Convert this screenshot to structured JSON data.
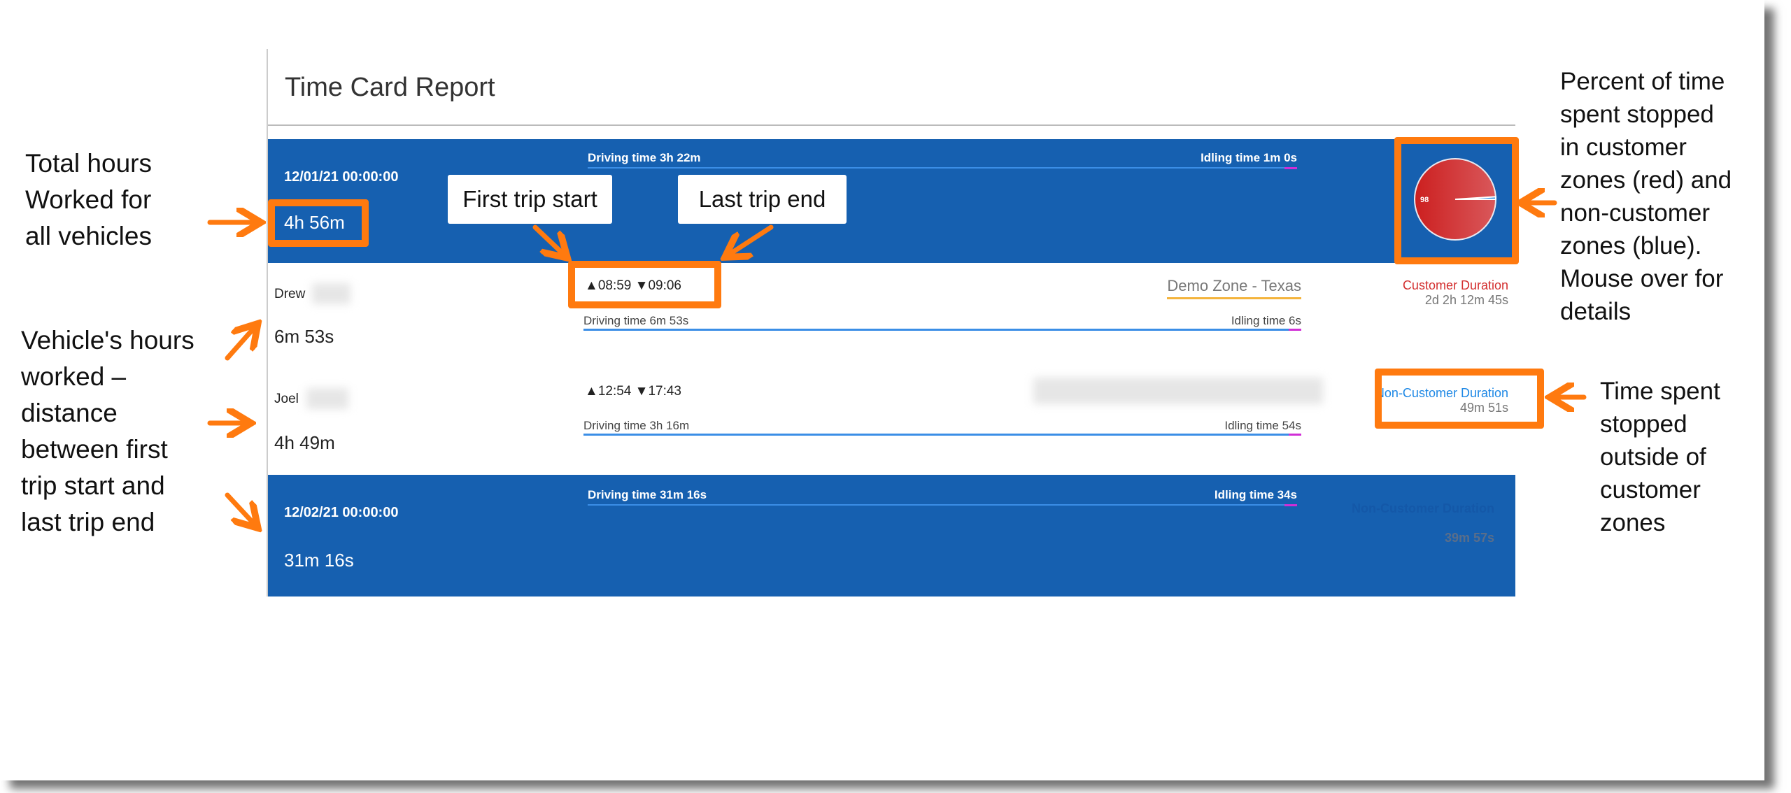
{
  "report": {
    "title": "Time Card Report"
  },
  "days": [
    {
      "date": "12/01/21 00:00:00",
      "total": "4h 56m",
      "driving": "Driving time 3h 22m",
      "idling": "Idling time 1m 0s",
      "pie": {
        "customer_percent": 98,
        "non_customer_percent": 2,
        "label": "98",
        "customer_color": "#d32f2f",
        "non_customer_color": "#1e88e5"
      },
      "vehicles": [
        {
          "name": "Drew",
          "hours": "6m 53s",
          "start": "08:59",
          "end": "09:06",
          "zone": "Demo Zone - Texas",
          "driving": "Driving time 6m 53s",
          "idling": "Idling time 6s",
          "duration_label": "Customer Duration",
          "duration_value": "2d 2h 12m 45s"
        },
        {
          "name": "Joel",
          "hours": "4h 49m",
          "start": "12:54",
          "end": "17:43",
          "driving": "Driving time 3h 16m",
          "idling": "Idling time 54s",
          "duration_label": "Non-Customer Duration",
          "duration_value": "49m 51s"
        }
      ]
    },
    {
      "date": "12/02/21 00:00:00",
      "total": "31m 16s",
      "driving": "Driving time 31m 16s",
      "idling": "Idling time 34s",
      "duration_label": "Non-Customer Duration",
      "duration_value": "39m 57s"
    }
  ],
  "annotations": {
    "total_hours": [
      "Total hours",
      "Worked for",
      "all vehicles"
    ],
    "vehicle_hours": [
      "Vehicle's hours",
      "worked –",
      "distance",
      "between first",
      "trip start and",
      "last trip end"
    ],
    "first_trip": "First trip start",
    "last_trip": "Last trip end",
    "pie": [
      "Percent of time",
      "spent stopped",
      "in customer",
      "zones (red) and",
      "non-customer",
      "zones (blue).",
      "Mouse over for",
      "details"
    ],
    "non_customer": [
      "Time spent",
      "stopped",
      "outside of",
      "customer",
      "zones"
    ]
  },
  "colors": {
    "band": "#1660b0",
    "annotation": "#ff7a0f",
    "customer": "#d32f2f",
    "non_customer": "#1e88e5",
    "zone_underline": "#f4b43c"
  },
  "icons": {
    "start": "triangle-up-icon",
    "end": "triangle-down-icon"
  }
}
